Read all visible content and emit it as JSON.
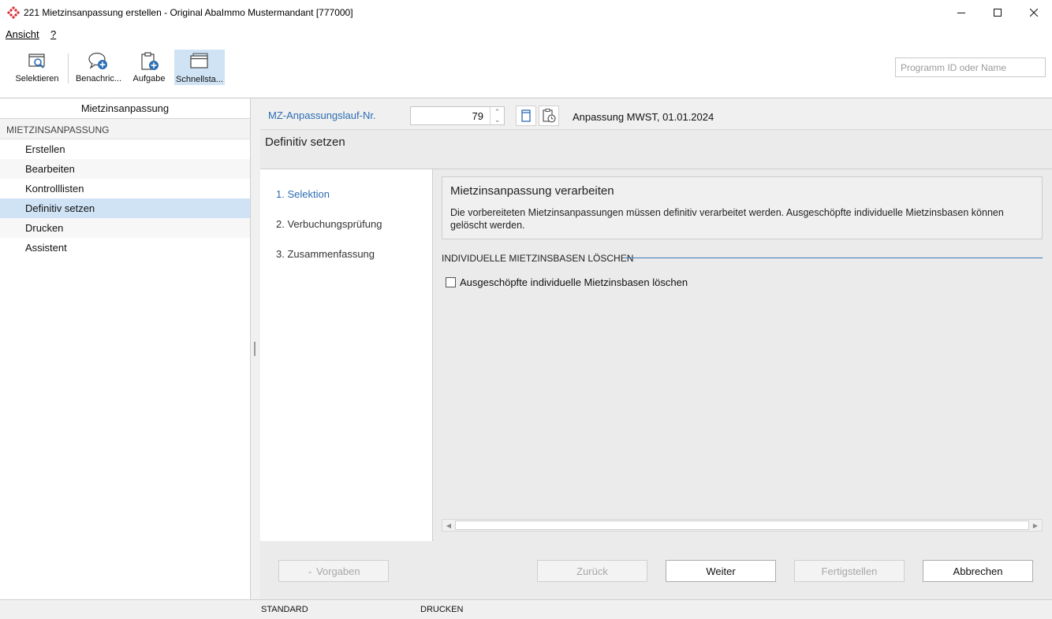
{
  "window": {
    "title": "221 Mietzinsanpassung erstellen - Original AbaImmo Mustermandant [777000]"
  },
  "menu": {
    "items": [
      {
        "label": "Ansicht"
      },
      {
        "label": "?"
      }
    ]
  },
  "toolbar": {
    "buttons": [
      {
        "label": "Selektieren",
        "icon": "search-window-icon"
      },
      {
        "label": "Benachric...",
        "icon": "message-add-icon"
      },
      {
        "label": "Aufgabe",
        "icon": "clipboard-add-icon"
      },
      {
        "label": "Schnellsta...",
        "icon": "windows-icon",
        "active": true
      }
    ],
    "search_placeholder": "Programm ID oder Name"
  },
  "sidebar": {
    "header": "Mietzinsanpassung",
    "group": "MIETZINSANPASSUNG",
    "items": [
      {
        "label": "Erstellen"
      },
      {
        "label": "Bearbeiten"
      },
      {
        "label": "Kontrolllisten"
      },
      {
        "label": "Definitiv setzen",
        "selected": true
      },
      {
        "label": "Drucken"
      },
      {
        "label": "Assistent"
      }
    ]
  },
  "main": {
    "run_label": "MZ-Anpassungslauf-Nr.",
    "run_number": "79",
    "run_description": "Anpassung MWST, 01.01.2024",
    "section_title": "Definitiv setzen",
    "steps": [
      {
        "label": "1. Selektion",
        "active": true
      },
      {
        "label": "2. Verbuchungsprüfung"
      },
      {
        "label": "3. Zusammenfassung"
      }
    ],
    "info": {
      "title": "Mietzinsanpassung verarbeiten",
      "text": "Die vorbereiteten Mietzinsanpassungen müssen definitiv verarbeitet werden. Ausgeschöpfte individuelle Mietzinsbasen können gelöscht werden."
    },
    "group_title": "INDIVIDUELLE MIETZINSBASEN LÖSCHEN",
    "checkbox": {
      "label": "Ausgeschöpfte individuelle Mietzinsbasen löschen",
      "checked": false
    }
  },
  "footer": {
    "vorgaben": "Vorgaben",
    "zurueck": "Zurück",
    "weiter": "Weiter",
    "fertigstellen": "Fertigstellen",
    "abbrechen": "Abbrechen"
  },
  "statusbar": {
    "left": "STANDARD",
    "right": "DRUCKEN"
  },
  "colors": {
    "accent": "#2d6db3",
    "selection": "#cfe3f5",
    "logo_red": "#d9303a"
  }
}
